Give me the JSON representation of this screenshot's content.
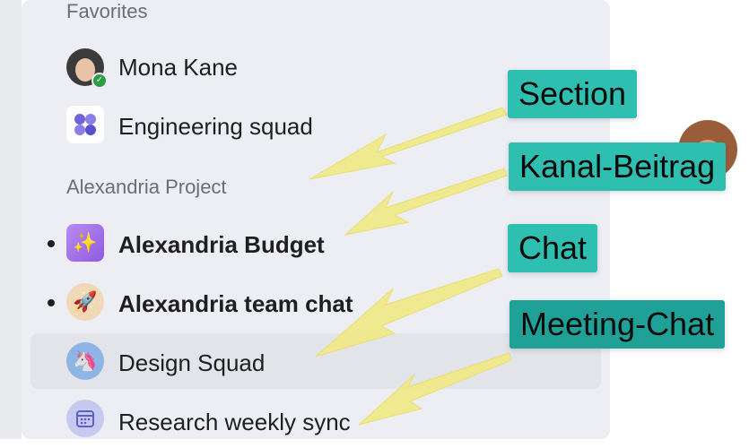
{
  "sidebar": {
    "section_favorites": "Favorites",
    "section_project": "Alexandria Project",
    "items": [
      {
        "label": "Mona Kane",
        "icon": "person-avatar",
        "status": "available",
        "bold": false
      },
      {
        "label": "Engineering squad",
        "icon": "group-grid-icon",
        "bold": false
      },
      {
        "label": "Alexandria Budget",
        "icon": "sparkle-icon",
        "bold": true,
        "unread": true
      },
      {
        "label": "Alexandria team chat",
        "icon": "rocket-icon",
        "bold": true,
        "unread": true
      },
      {
        "label": "Design Squad",
        "icon": "unicorn-icon",
        "bold": false,
        "selected": true
      },
      {
        "label": "Research weekly sync",
        "icon": "calendar-icon",
        "bold": false
      }
    ]
  },
  "callouts": {
    "section": "Section",
    "channel_post": "Kanal-Beitrag",
    "chat": "Chat",
    "meeting_chat": "Meeting-Chat"
  },
  "colors": {
    "callout_teal": "#2fbfb1",
    "arrow_yellow": "#f0e98a",
    "panel_bg": "#eceef3",
    "status_green": "#2e9c43"
  }
}
